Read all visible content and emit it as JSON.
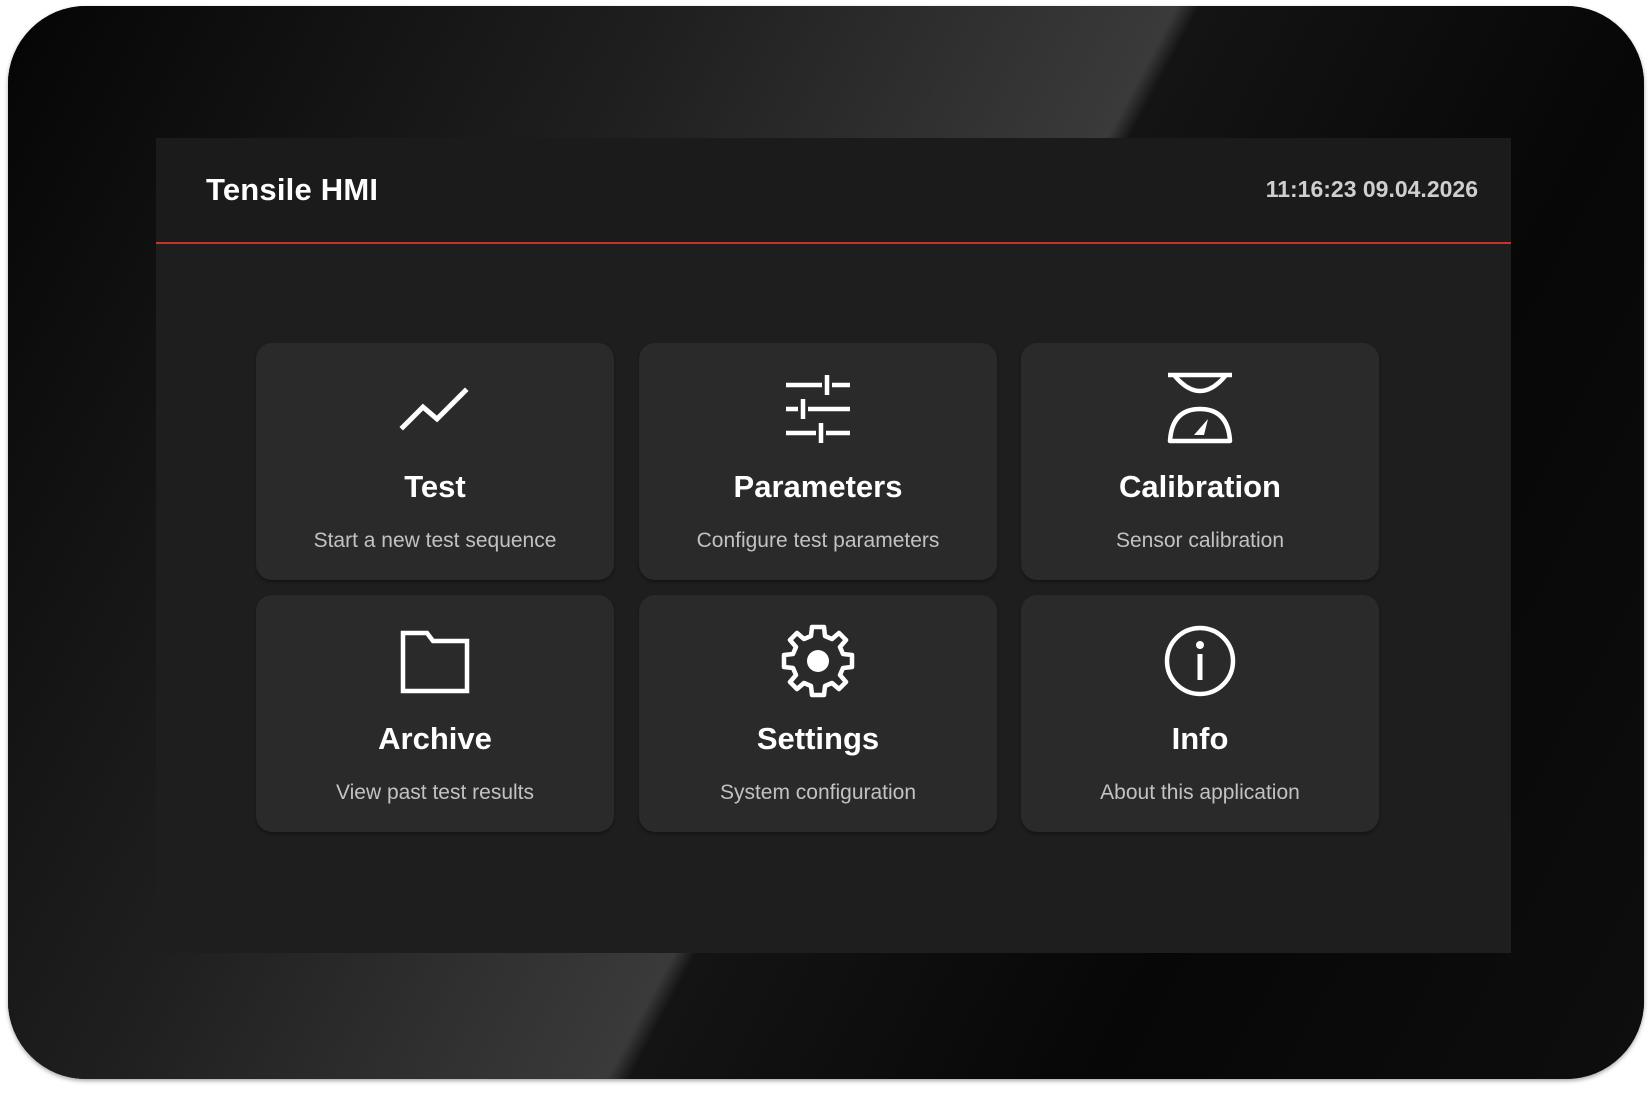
{
  "header": {
    "title": "Tensile HMI",
    "datetime": "11:16:23 09.04.2026"
  },
  "colors": {
    "accent": "#c8322d",
    "tile_background": "#2a2a2b",
    "screen_background": "#1e1e1f"
  },
  "menu": {
    "tiles": [
      {
        "label": "Test",
        "description": "Start a new test sequence",
        "icon": "trend-line-icon"
      },
      {
        "label": "Parameters",
        "description": "Configure test parameters",
        "icon": "sliders-icon"
      },
      {
        "label": "Calibration",
        "description": "Sensor calibration",
        "icon": "scale-gauge-icon"
      },
      {
        "label": "Archive",
        "description": "View past test results",
        "icon": "folder-icon"
      },
      {
        "label": "Settings",
        "description": "System configuration",
        "icon": "gear-icon"
      },
      {
        "label": "Info",
        "description": "About this application",
        "icon": "info-icon"
      }
    ]
  }
}
